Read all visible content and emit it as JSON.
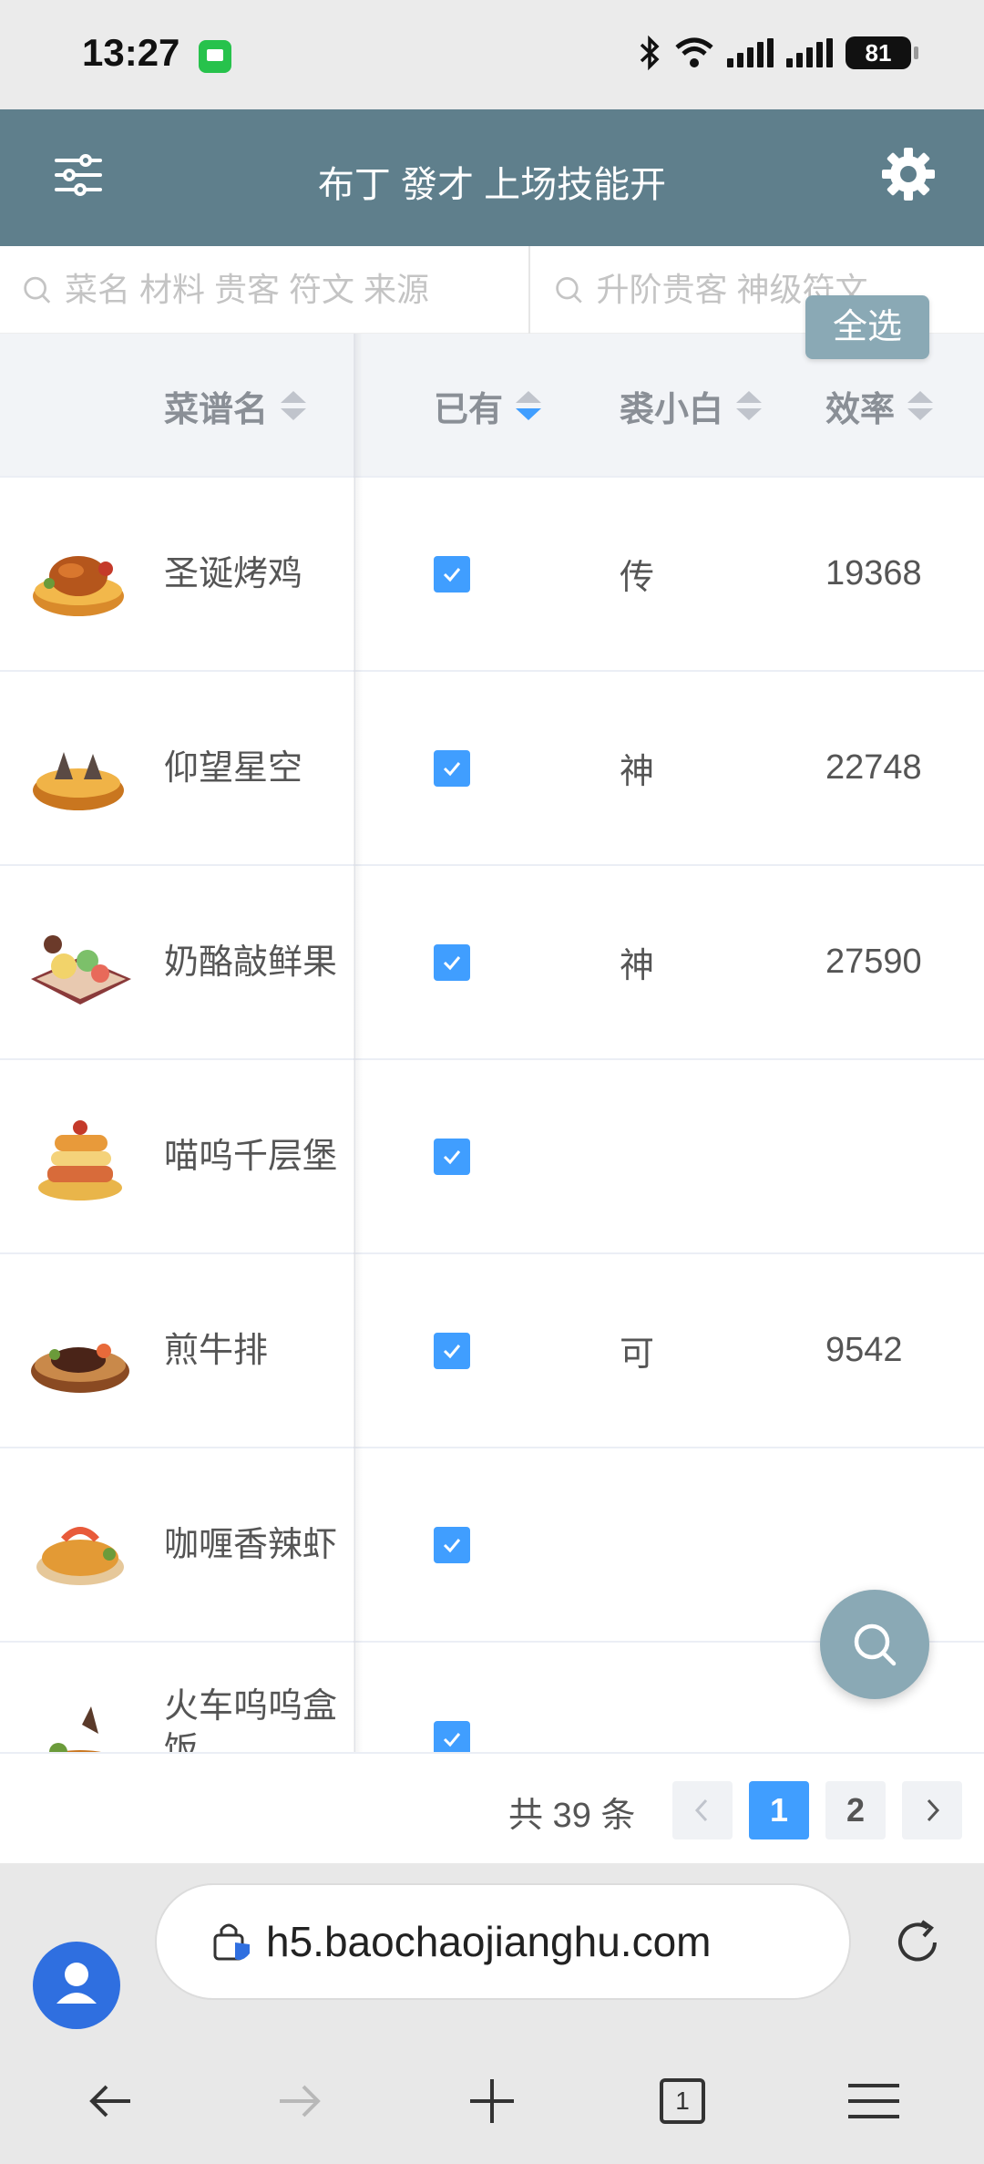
{
  "status_bar": {
    "time": "13:27",
    "battery": "81"
  },
  "header": {
    "title": "布丁 發才 上场技能开"
  },
  "search": {
    "left_placeholder": "菜名 材料 贵客 符文 来源",
    "right_placeholder": "升阶贵客 神级符文"
  },
  "select_all_label": "全选",
  "table": {
    "columns": {
      "name": "菜谱名",
      "owned": "已有",
      "rank": "裘小白",
      "efficiency": "效率"
    },
    "rows": [
      {
        "name": "圣诞烤鸡",
        "owned": true,
        "rank": "传",
        "efficiency": "19368"
      },
      {
        "name": "仰望星空",
        "owned": true,
        "rank": "神",
        "efficiency": "22748"
      },
      {
        "name": "奶酪敲鲜果",
        "owned": true,
        "rank": "神",
        "efficiency": "27590"
      },
      {
        "name": "喵呜千层堡",
        "owned": true,
        "rank": "",
        "efficiency": ""
      },
      {
        "name": "煎牛排",
        "owned": true,
        "rank": "可",
        "efficiency": "9542"
      },
      {
        "name": "咖喱香辣虾",
        "owned": true,
        "rank": "",
        "efficiency": ""
      },
      {
        "name": "火车呜呜盒饭",
        "owned": true,
        "rank": "",
        "efficiency": ""
      }
    ]
  },
  "pagination": {
    "total": "共 39 条",
    "pages": [
      "1",
      "2"
    ],
    "current": "1"
  },
  "browser": {
    "url": "h5.baochaojianghu.com",
    "tab_count": "1"
  }
}
